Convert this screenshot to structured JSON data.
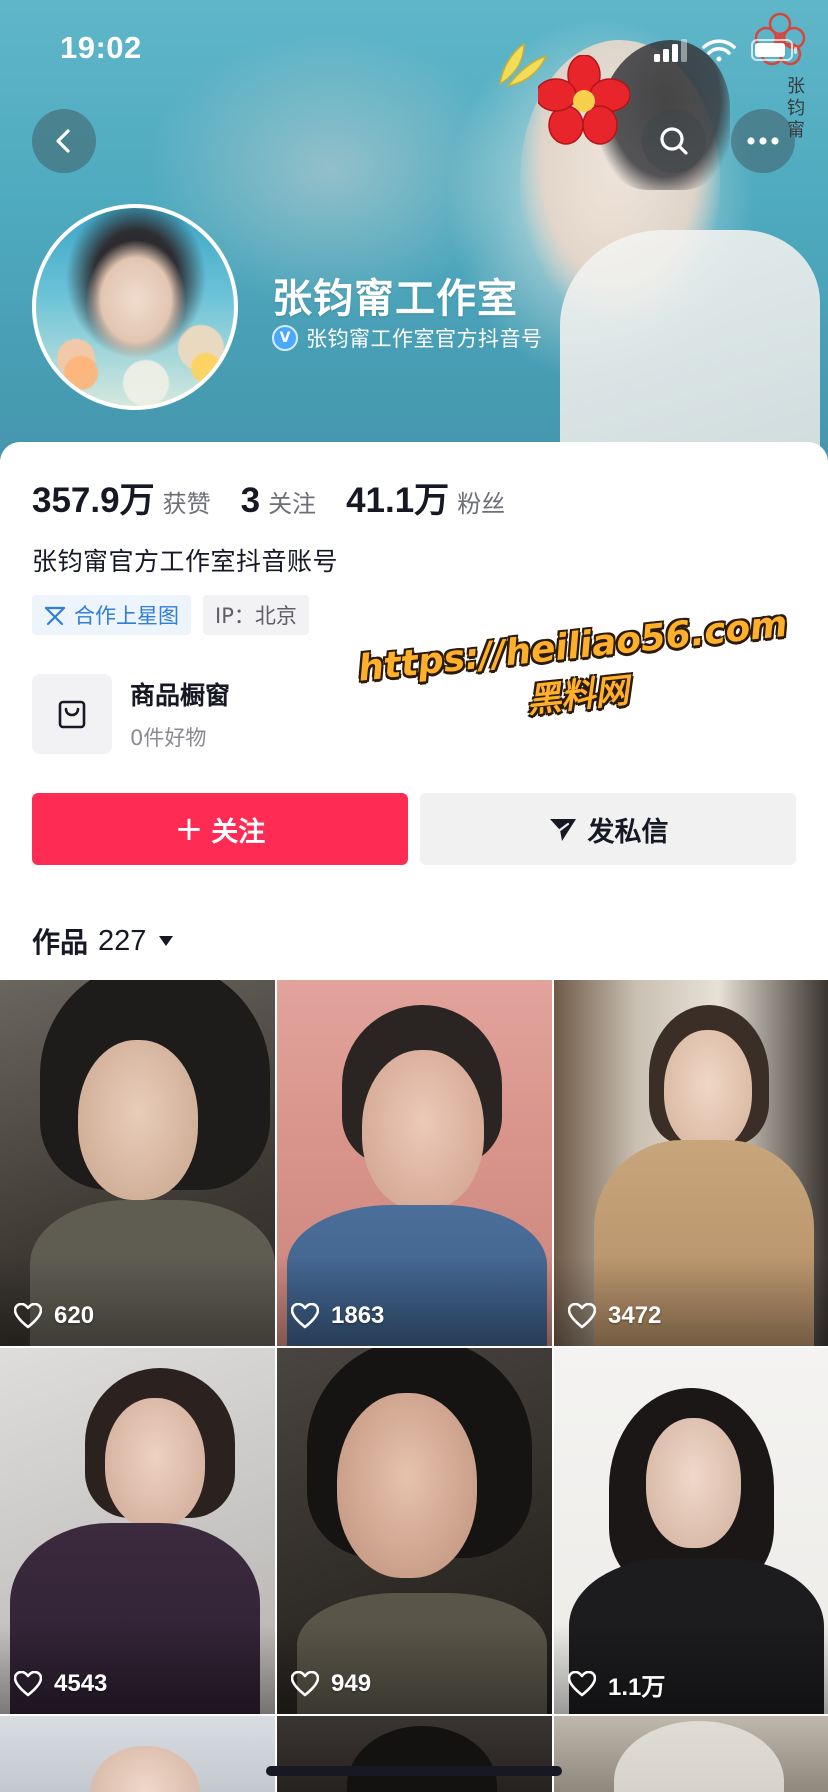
{
  "status_bar": {
    "time": "19:02"
  },
  "banner": {
    "seal_text": "张钧甯",
    "vertical_text": "张钧甯"
  },
  "header": {
    "back_icon": "chevron-left-icon",
    "search_icon": "search-icon",
    "more_icon": "more-dots-icon"
  },
  "profile": {
    "name": "张钧甯工作室",
    "verified_badge": "V",
    "verified_text": "张钧甯工作室官方抖音号"
  },
  "stats": [
    {
      "value": "357.9万",
      "label": "获赞"
    },
    {
      "value": "3",
      "label": "关注"
    },
    {
      "value": "41.1万",
      "label": "粉丝"
    }
  ],
  "bio": "张钧甯官方工作室抖音账号",
  "tags": {
    "star": "合作上星图",
    "ip": "IP：北京"
  },
  "shop": {
    "title": "商品橱窗",
    "subtitle": "0件好物"
  },
  "watermark": {
    "url": "https://heiliao56.com",
    "name": "黑料网"
  },
  "actions": {
    "follow_plus": "+",
    "follow_label": "关注",
    "message_label": "发私信"
  },
  "works": {
    "label": "作品",
    "count": "227"
  },
  "videos": [
    {
      "likes": "620"
    },
    {
      "likes": "1863"
    },
    {
      "likes": "3472"
    },
    {
      "likes": "4543"
    },
    {
      "likes": "949"
    },
    {
      "likes": "1.1万"
    }
  ],
  "colors": {
    "accent": "#fe2c55",
    "banner": "#4eaabf",
    "tag_blue": "#2f7ed8",
    "text_primary": "#161823",
    "text_secondary": "#6e6f76"
  }
}
